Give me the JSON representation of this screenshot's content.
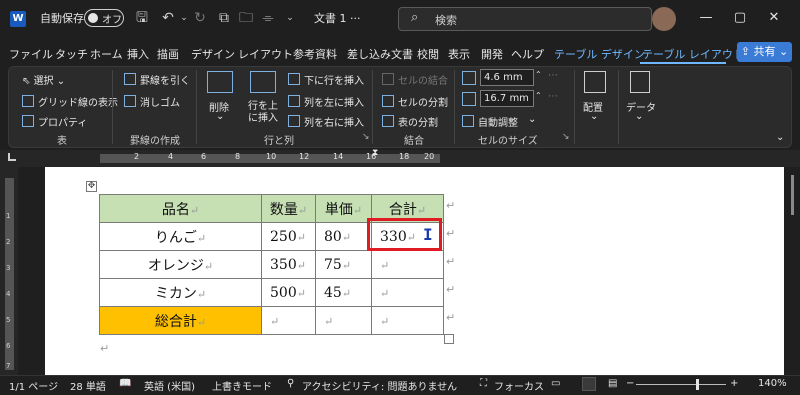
{
  "titlebar": {
    "app_icon": "W",
    "autosave_label": "自動保存",
    "autosave_state": "オフ",
    "doc_title": "文書 1",
    "doc_suffix": "···",
    "search_placeholder": "検索",
    "icons": [
      "save-icon",
      "undo-icon",
      "redo-icon",
      "new-document-icon",
      "folder-icon",
      "customize-icon"
    ]
  },
  "menu": {
    "tabs": [
      "ファイル",
      "タッチ",
      "ホーム",
      "挿入",
      "描画",
      "デザイン",
      "レイアウト",
      "参考資料",
      "差し込み文書",
      "校閲",
      "表示",
      "開発",
      "ヘルプ",
      "テーブル デザイン",
      "テーブル レイアウト"
    ],
    "active_tab": "テーブル レイアウト",
    "share_label": "共有"
  },
  "ribbon": {
    "table_group": {
      "label": "表",
      "select": "選択",
      "gridlines": "グリッド線の表示",
      "properties": "プロパティ"
    },
    "draw_group": {
      "label": "罫線の作成",
      "draw_table": "罫線を引く",
      "eraser": "消しゴム"
    },
    "rows_cols_group": {
      "label": "行と列",
      "delete": "削除",
      "insert_above": "行を上に挿入",
      "insert_above_l1": "行を上",
      "insert_above_l2": "に挿入",
      "insert_below": "下に行を挿入",
      "insert_left": "列を左に挿入",
      "insert_right": "列を右に挿入"
    },
    "merge_group": {
      "label": "結合",
      "merge_cells": "セルの結合",
      "split_cells": "セルの分割",
      "split_table": "表の分割"
    },
    "cellsize_group": {
      "label": "セルのサイズ",
      "height": "4.6 mm",
      "width": "16.7 mm",
      "autofit": "自動調整"
    },
    "alignment": {
      "label": "配置"
    },
    "data": {
      "label": "データ"
    }
  },
  "ruler": {
    "numbers": [
      "2",
      "4",
      "6",
      "8",
      "10",
      "12",
      "14",
      "16",
      "18",
      "20"
    ]
  },
  "vruler": {
    "numbers": [
      "1",
      "2",
      "3",
      "4",
      "5",
      "6",
      "7"
    ]
  },
  "table": {
    "headers": [
      "品名",
      "数量",
      "単価",
      "合計"
    ],
    "rows": [
      [
        "りんご",
        "250",
        "80",
        "330"
      ],
      [
        "オレンジ",
        "350",
        "75",
        ""
      ],
      [
        "ミカン",
        "500",
        "45",
        ""
      ],
      [
        "総合計",
        "",
        "",
        ""
      ]
    ],
    "mark": "↵",
    "colors": {
      "header_bg": "#c6e0b4",
      "total_bg": "#ffc000",
      "selection": "#e01b24"
    }
  },
  "statusbar": {
    "page": "1/1 ページ",
    "words": "28 単語",
    "language": "英語 (米国)",
    "mode": "上書きモード",
    "accessibility": "アクセシビリティ: 問題ありません",
    "focus": "フォーカス",
    "zoom_minus": "−",
    "zoom_plus": "+",
    "zoom": "140%"
  }
}
